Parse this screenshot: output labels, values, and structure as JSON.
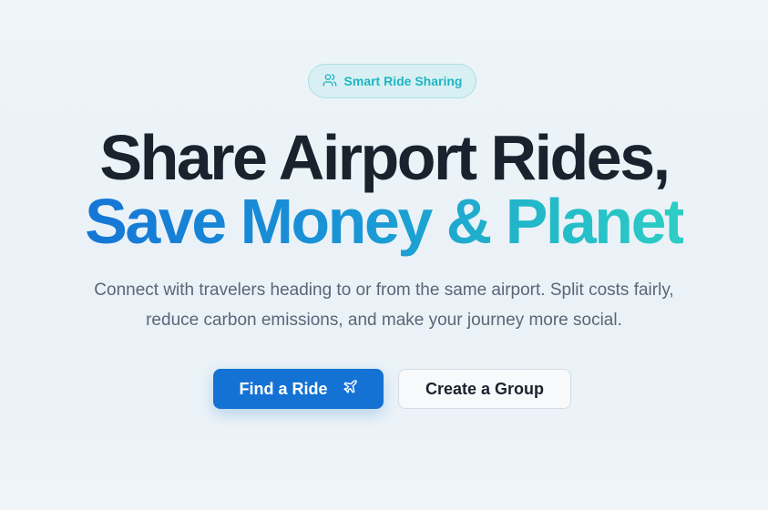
{
  "hero": {
    "badge": {
      "icon": "users-icon",
      "label": "Smart Ride Sharing"
    },
    "headline_line1": "Share Airport Rides,",
    "headline_line2": "Save Money & Planet",
    "subtitle_line1": "Connect with travelers heading to or from the same airport. Split costs fairly,",
    "subtitle_line2": "reduce carbon emissions, and make your journey more social.",
    "primary_button": {
      "label": "Find a Ride",
      "icon": "plane-icon"
    },
    "secondary_button": {
      "label": "Create a Group"
    }
  },
  "colors": {
    "primary": "#1472d4",
    "accent_teal": "#1fb5c4",
    "heading": "#1a222d",
    "body_text": "#5a6678"
  }
}
